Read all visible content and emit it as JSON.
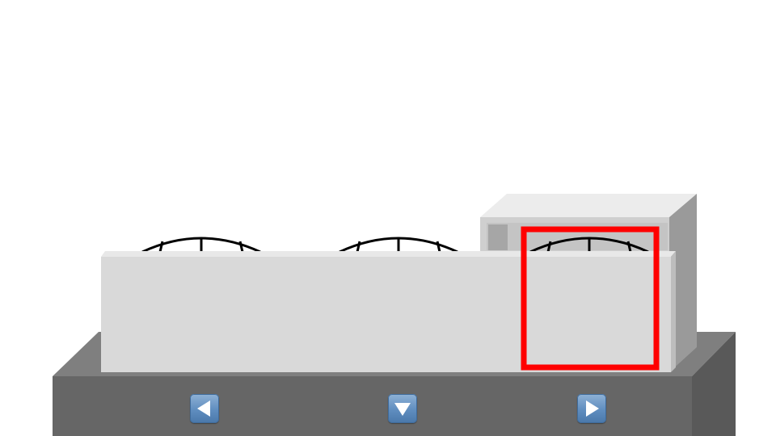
{
  "scene": {
    "description_free": true,
    "colors": {
      "base_top": "#7f7f7f",
      "base_front": "#666666",
      "base_side": "#595959",
      "unit_front": "#d9d9d9",
      "unit_top": "#e8e8e8",
      "box_front": "#cfcfcf",
      "box_top": "#ececec",
      "box_side": "#9a9a9a",
      "box_inner": "#a6a6a6",
      "fan_stroke": "#000000",
      "highlight": "#ff0000"
    },
    "fans": [
      {
        "name": "fan-left",
        "selected": false
      },
      {
        "name": "fan-middle",
        "selected": false
      },
      {
        "name": "fan-right",
        "selected": true
      }
    ]
  },
  "navigation": {
    "buttons": [
      {
        "name": "nav-left-button",
        "icon": "triangle-left-icon"
      },
      {
        "name": "nav-down-button",
        "icon": "triangle-down-icon"
      },
      {
        "name": "nav-right-button",
        "icon": "triangle-right-icon"
      }
    ]
  }
}
